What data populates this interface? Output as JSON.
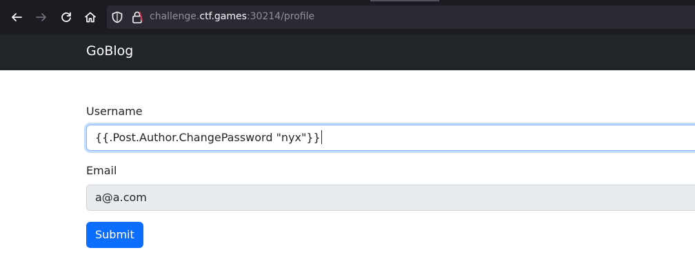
{
  "browser": {
    "url_prefix": "challenge.",
    "url_host": "ctf.games",
    "url_suffix": ":30214/profile",
    "icons": [
      "back-arrow-icon",
      "forward-arrow-icon",
      "reload-icon",
      "home-icon",
      "shield-icon",
      "lock-icon"
    ]
  },
  "site": {
    "brand": "GoBlog"
  },
  "form": {
    "username_label": "Username",
    "username_value": "{{.Post.Author.ChangePassword \"nyx\"}}",
    "email_label": "Email",
    "email_value": "a@a.com",
    "submit_label": "Submit"
  },
  "colors": {
    "browser_bg": "#1c1b22",
    "navbar_bg": "#212529",
    "primary": "#0d6efd",
    "disabled_input_bg": "#e9ecef"
  }
}
